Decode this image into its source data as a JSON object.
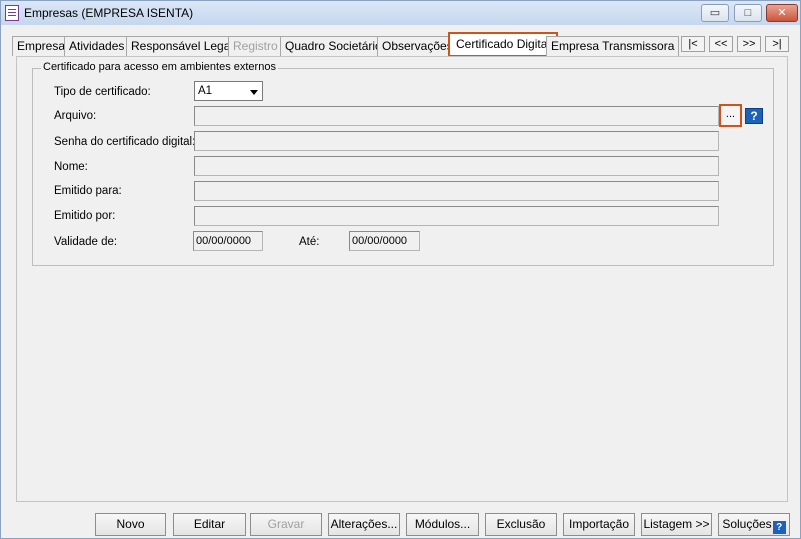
{
  "window": {
    "title": "Empresas (EMPRESA ISENTA)",
    "min_glyph": "▭",
    "restore_glyph": "□",
    "close_glyph": "✕"
  },
  "tabs": [
    {
      "label": "Empresa"
    },
    {
      "label": "Atividades"
    },
    {
      "label": "Responsável Legal"
    },
    {
      "label": "Registro",
      "disabled": true
    },
    {
      "label": "Quadro Societário"
    },
    {
      "label": "Observações"
    },
    {
      "label": "Certificado Digital",
      "active": true
    },
    {
      "label": "Empresa Transmissora"
    }
  ],
  "nav": {
    "first": "|<",
    "prev": "<<",
    "next": ">>",
    "last": ">|"
  },
  "group": {
    "title": "Certificado para acesso em ambientes externos",
    "tipo_label": "Tipo de certificado:",
    "tipo_value": "A1",
    "arquivo_label": "Arquivo:",
    "arquivo_value": "",
    "browse_label": "...",
    "help_label": "?",
    "senha_label": "Senha do certificado digital:",
    "nome_label": "Nome:",
    "emitido_para_label": "Emitido para:",
    "emitido_por_label": "Emitido por:",
    "validade_label": "Validade de:",
    "validade_de": "00/00/0000",
    "ate_label": "Até:",
    "validade_ate": "00/00/0000"
  },
  "buttons": {
    "novo": "Novo",
    "editar": "Editar",
    "gravar": "Gravar",
    "alteracoes": "Alterações...",
    "modulos": "Módulos...",
    "exclusao": "Exclusão",
    "importacao": "Importação",
    "listagem": "Listagem >>",
    "solucoes": "Soluções",
    "solucoes_help": "?"
  },
  "colors": {
    "highlight": "#d2531a",
    "help_blue": "#1c62b9"
  }
}
